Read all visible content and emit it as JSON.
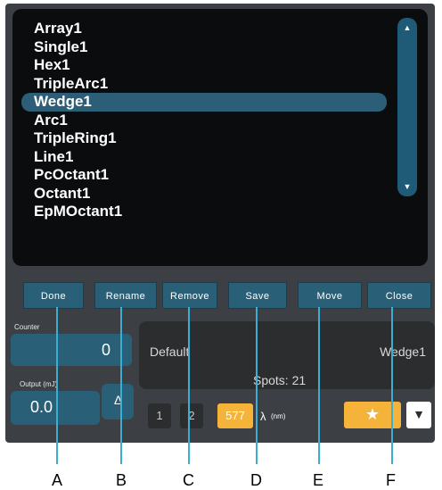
{
  "list": {
    "items": [
      "Array1",
      "Single1",
      "Hex1",
      "TripleArc1",
      "Wedge1",
      "Arc1",
      "TripleRing1",
      "Line1",
      "PcOctant1",
      "Octant1",
      "EpMOctant1"
    ],
    "selected_index": 4
  },
  "buttons": {
    "done": "Done",
    "rename": "Rename",
    "remove": "Remove",
    "save": "Save",
    "move": "Move",
    "close": "Close"
  },
  "counter": {
    "label": "Counter",
    "value": "0"
  },
  "output": {
    "label": "Output (mJ)",
    "value": "0.0",
    "delta_symbol": "Δ"
  },
  "info": {
    "name_left": "Default",
    "name_right": "Wedge1",
    "spots": "Spots: 21"
  },
  "bottom": {
    "btn1": "1",
    "btn2": "2",
    "wavelength": "577",
    "lambda_label": "λ",
    "lambda_unit": "(nm)"
  },
  "annotations": [
    "A",
    "B",
    "C",
    "D",
    "E",
    "F"
  ],
  "colors": {
    "accent": "#2a5f78",
    "selected": "#2c5f77",
    "wavelength": "#f6b33a",
    "star": "#f6b33a",
    "callout_line": "#3aaed3"
  }
}
